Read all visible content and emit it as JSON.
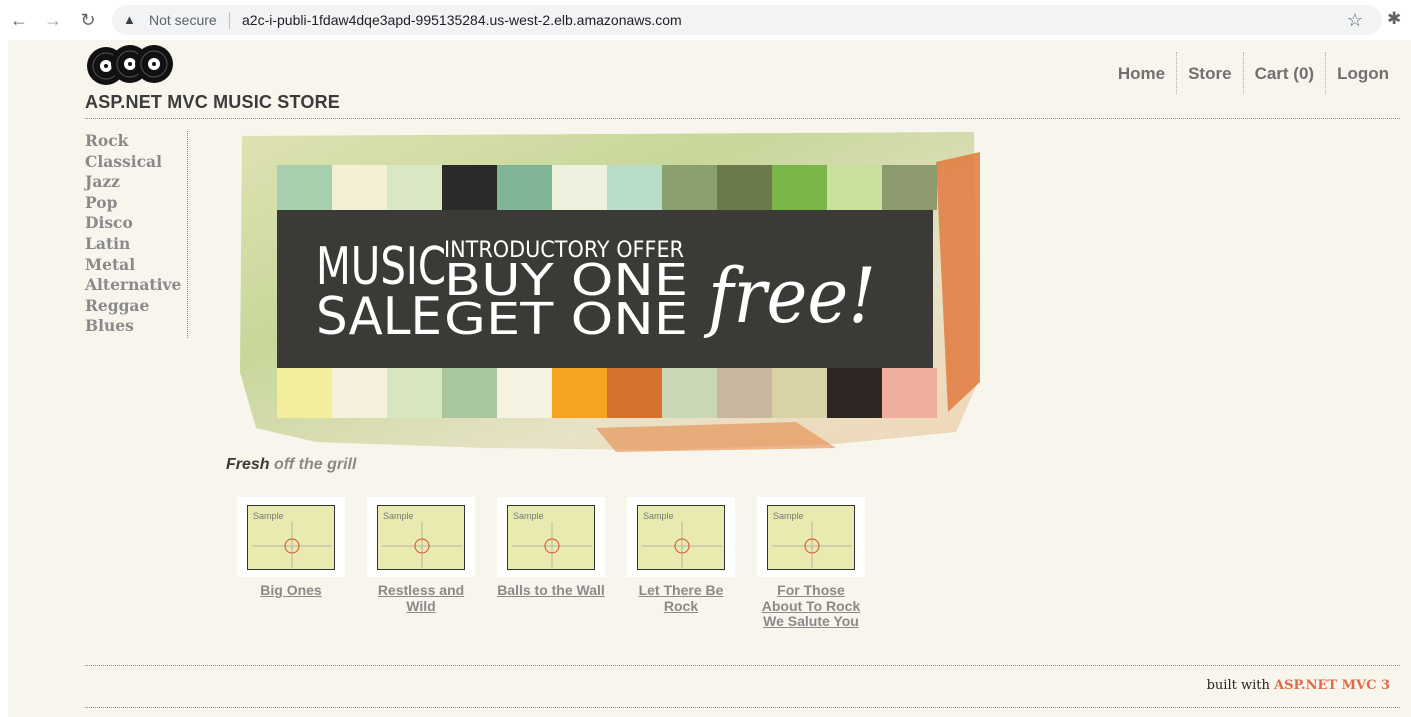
{
  "browser": {
    "security_label": "Not secure",
    "url": "a2c-i-publi-1fdaw4dqe3apd-995135284.us-west-2.elb.amazonaws.com",
    "icons": [
      "back-arrow-icon",
      "forward-arrow-icon",
      "reload-icon",
      "warning-icon",
      "star-icon",
      "extension-icon"
    ]
  },
  "site": {
    "title": "ASP.NET MVC MUSIC STORE"
  },
  "nav": {
    "home": "Home",
    "store": "Store",
    "cart": "Cart (0)",
    "logon": "Logon"
  },
  "genres": [
    "Rock",
    "Classical",
    "Jazz",
    "Pop",
    "Disco",
    "Latin",
    "Metal",
    "Alternative",
    "Reggae",
    "Blues"
  ],
  "banner": {
    "word1": "MUSIC",
    "word2": "SALE",
    "line1": "INTRODUCTORY OFFER",
    "line2": "BUY ONE",
    "line3": "GET ONE",
    "script": "free!"
  },
  "fresh": {
    "word1": "Fresh",
    "word2": "off the grill"
  },
  "albums": [
    {
      "sample": "Sample",
      "title": "Big Ones"
    },
    {
      "sample": "Sample",
      "title": "Restless and Wild"
    },
    {
      "sample": "Sample",
      "title": "Balls to the Wall"
    },
    {
      "sample": "Sample",
      "title": "Let There Be Rock"
    },
    {
      "sample": "Sample",
      "title": "For Those About To Rock We Salute You"
    }
  ],
  "footer": {
    "built_with": "built with",
    "brand": "ASP.NET MVC 3"
  }
}
